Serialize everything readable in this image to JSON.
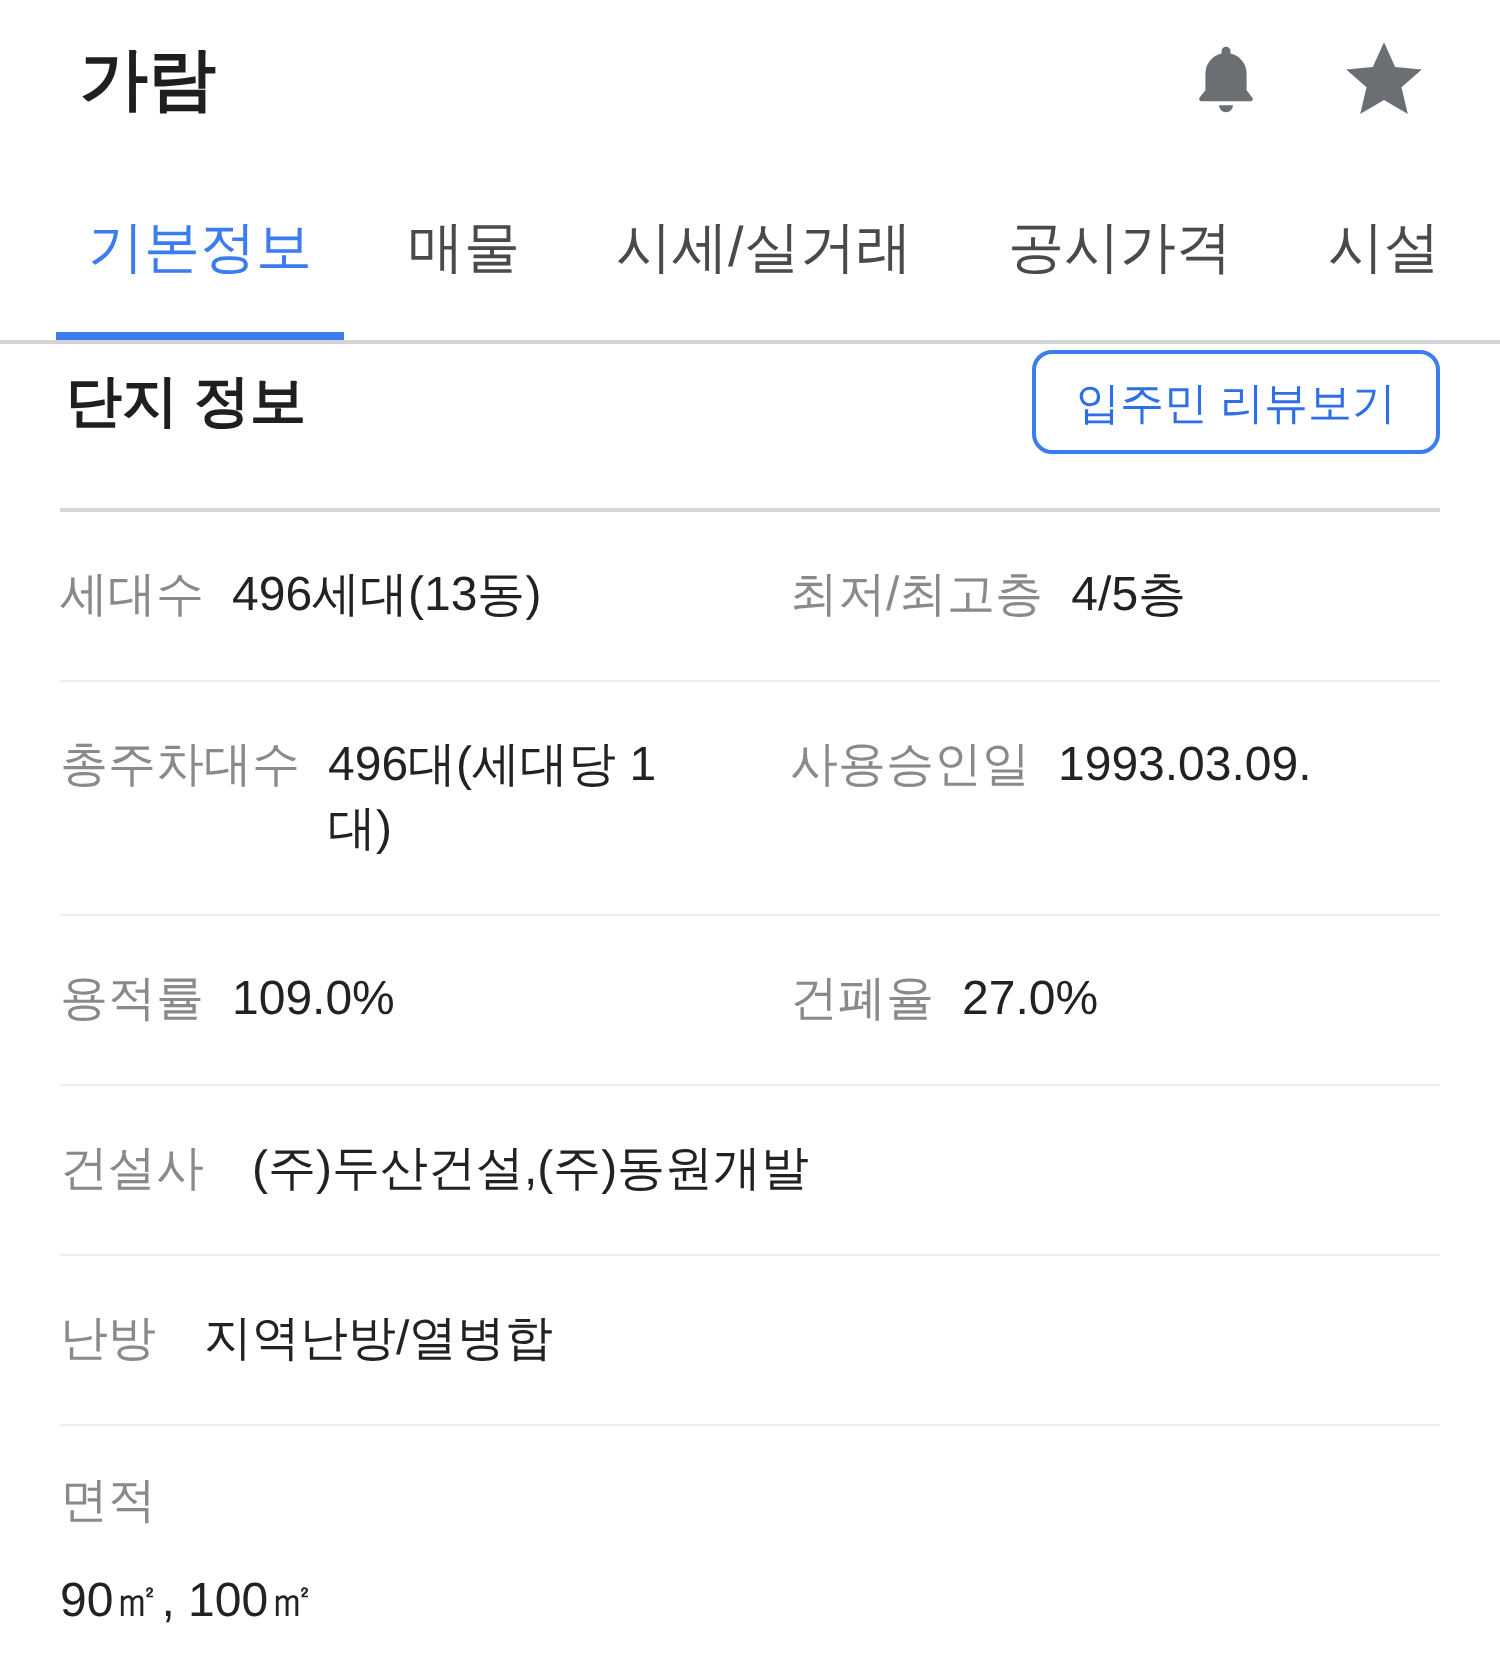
{
  "header": {
    "title": "가람"
  },
  "tabs": [
    {
      "label": "기본정보",
      "selected": true
    },
    {
      "label": "매물",
      "selected": false
    },
    {
      "label": "시세/실거래",
      "selected": false
    },
    {
      "label": "공시가격",
      "selected": false
    },
    {
      "label": "시설",
      "selected": false
    }
  ],
  "section": {
    "title": "단지 정보",
    "button": "입주민 리뷰보기"
  },
  "rows": [
    {
      "kind": "pair",
      "items": [
        {
          "label": "세대수",
          "value": "496세대(13동)"
        },
        {
          "label": "최저/최고층",
          "value": "4/5층"
        }
      ]
    },
    {
      "kind": "pair",
      "items": [
        {
          "label": "총주차대수",
          "value": "496대(세대당 1 대)"
        },
        {
          "label": "사용승인일",
          "value": "1993.03.09."
        }
      ]
    },
    {
      "kind": "pair",
      "items": [
        {
          "label": "용적률",
          "value": "109.0%"
        },
        {
          "label": "건폐율",
          "value": "27.0%"
        }
      ]
    },
    {
      "kind": "single",
      "items": [
        {
          "label": "건설사",
          "value": "(주)두산건설,(주)동원개발"
        }
      ]
    },
    {
      "kind": "single",
      "items": [
        {
          "label": "난방",
          "value": "지역난방/열병합"
        }
      ]
    },
    {
      "kind": "stacked",
      "items": [
        {
          "label": "면적",
          "value": "90㎡, 100㎡"
        }
      ]
    }
  ]
}
